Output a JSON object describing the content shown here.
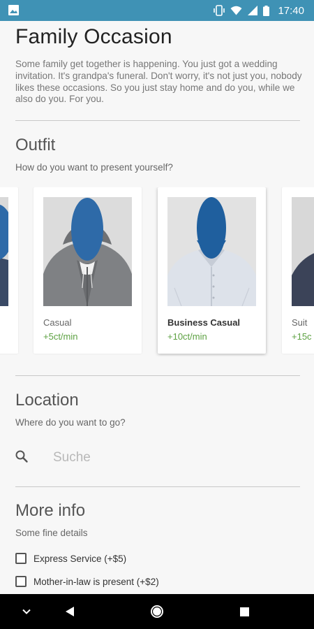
{
  "status_bar": {
    "time": "17:40"
  },
  "page": {
    "title": "Family Occasion",
    "description": "Some family get together is happening. You just got a wedding invitation. It's grandpa's funeral. Don't worry, it's not just you, nobody likes these occasions. So you just stay home and do you, while we also do you. For you."
  },
  "outfit": {
    "title": "Outfit",
    "subtitle": "How do you want to present yourself?",
    "items": [
      {
        "name": "",
        "price": ""
      },
      {
        "name": "Casual",
        "price": "+5ct/min"
      },
      {
        "name": "Business Casual",
        "price": "+10ct/min",
        "selected": true
      },
      {
        "name": "Suit",
        "price": "+15c"
      }
    ]
  },
  "location": {
    "title": "Location",
    "subtitle": "Where do you want to go?",
    "search_placeholder": "Suche"
  },
  "more_info": {
    "title": "More info",
    "subtitle": "Some fine details",
    "options": [
      {
        "label": "Express Service (+$5)",
        "checked": false
      },
      {
        "label": "Mother-in-law is present (+$2)",
        "checked": false
      }
    ]
  },
  "colors": {
    "status_bar": "#3f92b5",
    "price": "#5da142",
    "face": "#2e6aa8"
  }
}
